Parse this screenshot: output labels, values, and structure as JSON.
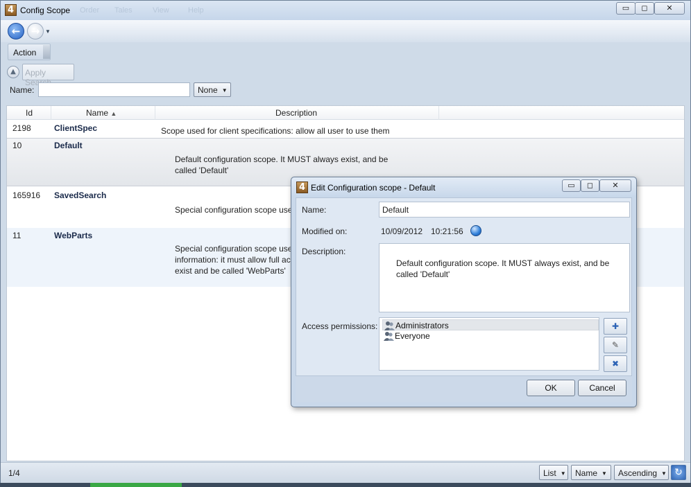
{
  "window": {
    "title": "Config Scope",
    "app_icon": "4",
    "ghost_menu": [
      "Order",
      "Tales",
      "View",
      "Help"
    ]
  },
  "toolbar": {
    "action_label": "Action",
    "apply_search_label": "Apply Search",
    "name_label": "Name:",
    "name_value": "",
    "match_mode": "None"
  },
  "list": {
    "columns": [
      "Id",
      "Name",
      "Description"
    ],
    "sort_indicator": "▲",
    "rows": [
      {
        "id": "2198",
        "name": "ClientSpec",
        "description": "Scope used for client specifications: allow all user to use them"
      },
      {
        "id": "10",
        "name": "Default",
        "description": "Default configuration scope. It MUST always exist, and be called 'Default'"
      },
      {
        "id": "165916",
        "name": "SavedSearch",
        "description": "Special configuration scope use"
      },
      {
        "id": "11",
        "name": "WebParts",
        "description": "Special configuration scope use\ninformation: it must allow full ac\nexist and be called 'WebParts'"
      }
    ]
  },
  "status": {
    "count": "1/4",
    "view_mode": "List",
    "sort_field": "Name",
    "sort_order": "Ascending"
  },
  "dialog": {
    "title": "Edit Configuration scope - Default",
    "name_label": "Name:",
    "name_value": "Default",
    "modified_label": "Modified on:",
    "modified_date": "10/09/2012",
    "modified_time": "10:21:56",
    "description_label": "Description:",
    "description_value": "Default configuration scope. It MUST always exist, and be called 'Default'",
    "permissions_label": "Access permissions:",
    "permissions": [
      "Administrators",
      "Everyone"
    ],
    "ok_label": "OK",
    "cancel_label": "Cancel"
  },
  "colors": {
    "selection_row": "#e8ebef",
    "alt_row": "#eef4fb",
    "accent": "#2f64b3"
  },
  "icons": [
    "back-arrow-icon",
    "forward-arrow-icon",
    "globe-icon",
    "user-group-icon",
    "add-permission-icon",
    "edit-permission-icon",
    "remove-permission-icon",
    "refresh-icon"
  ]
}
